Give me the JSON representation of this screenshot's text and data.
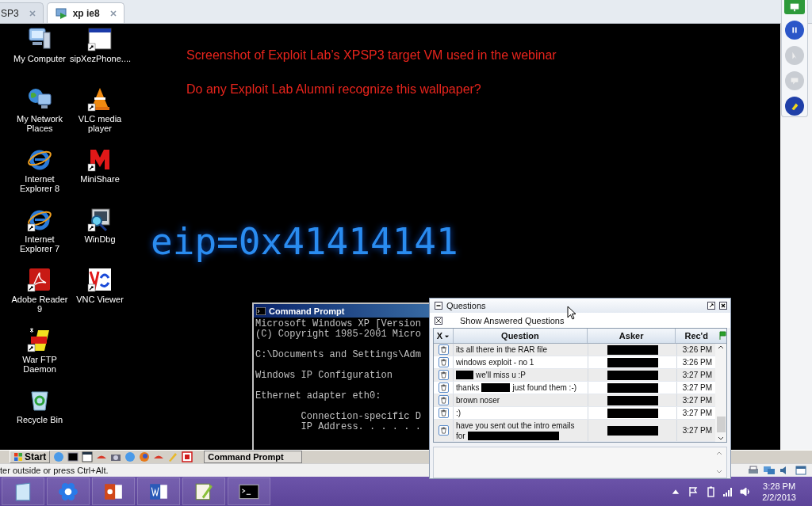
{
  "tabs": [
    {
      "label": "SP3",
      "selected": false
    },
    {
      "label": "xp ie8",
      "selected": true
    }
  ],
  "toolbar_buttons": [
    {
      "kind": "screen",
      "disabled": false
    },
    {
      "kind": "pause",
      "disabled": false
    },
    {
      "kind": "pointer",
      "disabled": true
    },
    {
      "kind": "chat",
      "disabled": true
    },
    {
      "kind": "highlighter",
      "disabled": false
    }
  ],
  "desktop_icon_columns": [
    [
      {
        "label": "My Computer",
        "kind": "computer",
        "shortcut": false
      },
      {
        "label": "My Network Places",
        "kind": "network",
        "shortcut": false
      },
      {
        "label": "Internet Explorer 8",
        "kind": "ie",
        "shortcut": false
      },
      {
        "label": "Internet Explorer 7",
        "kind": "ie",
        "shortcut": true
      },
      {
        "label": "Adobe Reader 9",
        "kind": "pdf",
        "shortcut": true
      },
      {
        "label": "War FTP Daemon",
        "kind": "ftp",
        "shortcut": true
      },
      {
        "label": "Recycle Bin",
        "kind": "recycle",
        "shortcut": false
      }
    ],
    [
      {
        "label": "sipXezPhone....",
        "kind": "window",
        "shortcut": true
      },
      {
        "label": "VLC media player",
        "kind": "vlc",
        "shortcut": true
      },
      {
        "label": "MiniShare",
        "kind": "minishare",
        "shortcut": true
      },
      {
        "label": "WinDbg",
        "kind": "windbg",
        "shortcut": true
      },
      {
        "label": "VNC Viewer",
        "kind": "vnc",
        "shortcut": true
      }
    ]
  ],
  "wallpaper": {
    "lines": [
      "Screenshot of Exploit Lab’s XPSP3 target VM used in the webinar",
      "Do any Exploit Lab Alumni recognize this wallpaper?"
    ],
    "banner": "eip=0x41414141"
  },
  "command_prompt": {
    "title": "Command Prompt",
    "blocks": [
      {
        "spaced": false,
        "lines": [
          "Microsoft Windows XP [Version",
          "(C) Copyright 1985-2001 Micro"
        ]
      },
      {
        "spaced": false,
        "lines": [
          "C:\\Documents and Settings\\Adm"
        ]
      },
      {
        "spaced": false,
        "lines": [
          "Windows IP Configuration"
        ]
      },
      {
        "spaced": true,
        "lines": [
          "Ethernet adapter eth0:"
        ]
      },
      {
        "spaced": false,
        "lines": [
          "        Connection-specific D",
          "        IP Address. . . . . ."
        ]
      }
    ]
  },
  "vm_taskbar": {
    "start": "Start",
    "task": "Command Prompt"
  },
  "status_bar": {
    "text": "ter outside or press Ctrl+Alt."
  },
  "questions_panel": {
    "title": "Questions",
    "show_answered": {
      "label": "Show Answered Questions",
      "checked": true
    },
    "columns": [
      "X",
      "Question",
      "Asker",
      "Rec'd"
    ],
    "rows": [
      {
        "question": [
          [
            {
              "kind": "text",
              "text": "its all there in the RAR file"
            }
          ]
        ],
        "time": "3:26 PM"
      },
      {
        "question": [
          [
            {
              "kind": "text",
              "text": "windows exploit - no 1"
            }
          ]
        ],
        "time": "3:26 PM"
      },
      {
        "question": [
          [
            {
              "kind": "redacted"
            },
            {
              "kind": "text",
              "text": "we'll miss u :P"
            }
          ]
        ],
        "time": "3:27 PM"
      },
      {
        "question": [
          [
            {
              "kind": "text",
              "text": "thanks"
            },
            {
              "kind": "redacted"
            },
            {
              "kind": "text",
              "text": "just found them :-)"
            }
          ]
        ],
        "time": "3:27 PM"
      },
      {
        "question": [
          [
            {
              "kind": "text",
              "text": "brown noser"
            }
          ]
        ],
        "time": "3:27 PM"
      },
      {
        "question": [
          [
            {
              "kind": "text",
              "text": ":)"
            }
          ]
        ],
        "time": "3:27 PM"
      },
      {
        "question": [
          [
            {
              "kind": "text",
              "text": "have you sent out the intro emails"
            }
          ],
          [
            {
              "kind": "text",
              "text": "for"
            },
            {
              "kind": "redacted"
            }
          ]
        ],
        "time": "3:27 PM"
      }
    ]
  },
  "clock": {
    "time": "3:28 PM",
    "date": "2/2/2013"
  }
}
